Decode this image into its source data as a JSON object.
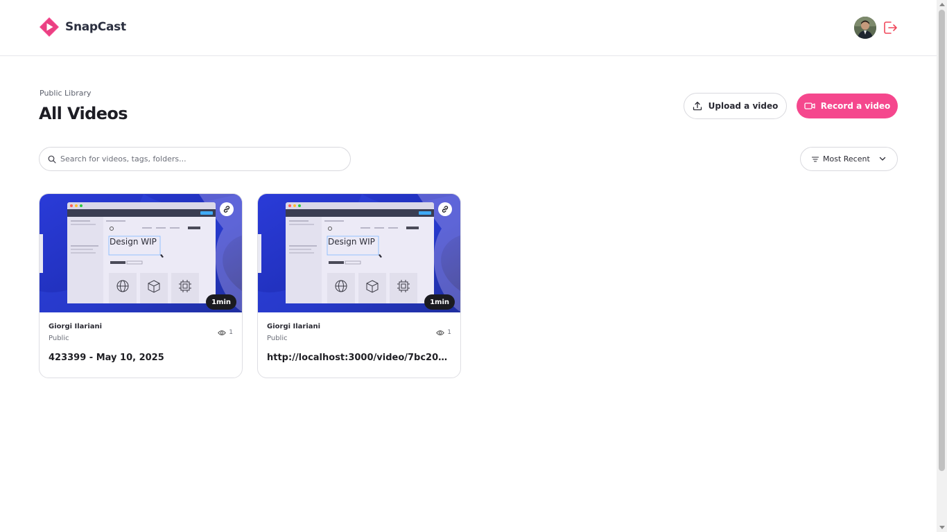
{
  "app": {
    "name": "SnapCast",
    "brand_color": "#f5478d",
    "logo_icon": "play-icon"
  },
  "header": {
    "avatar_icon": "user-avatar",
    "logout_icon": "logout-icon"
  },
  "page": {
    "subtitle": "Public Library",
    "title": "All Videos"
  },
  "actions": {
    "upload_label": "Upload a video",
    "upload_icon": "upload-icon",
    "record_label": "Record a video",
    "record_icon": "video-camera-icon"
  },
  "search": {
    "placeholder": "Search for videos, tags, folders...",
    "value": ""
  },
  "sort": {
    "selected": "Most Recent",
    "icon": "sort-lines-icon"
  },
  "videos": [
    {
      "author": "Giorgi Ilariani",
      "visibility": "Public",
      "views": "1",
      "duration": "1min",
      "title": "423399 - May 10, 2025",
      "thumbnail_text": "Design WIP"
    },
    {
      "author": "Giorgi Ilariani",
      "visibility": "Public",
      "views": "1",
      "duration": "1min",
      "title": "http://localhost:3000/video/7bc2073...",
      "thumbnail_text": "Design WIP"
    }
  ]
}
